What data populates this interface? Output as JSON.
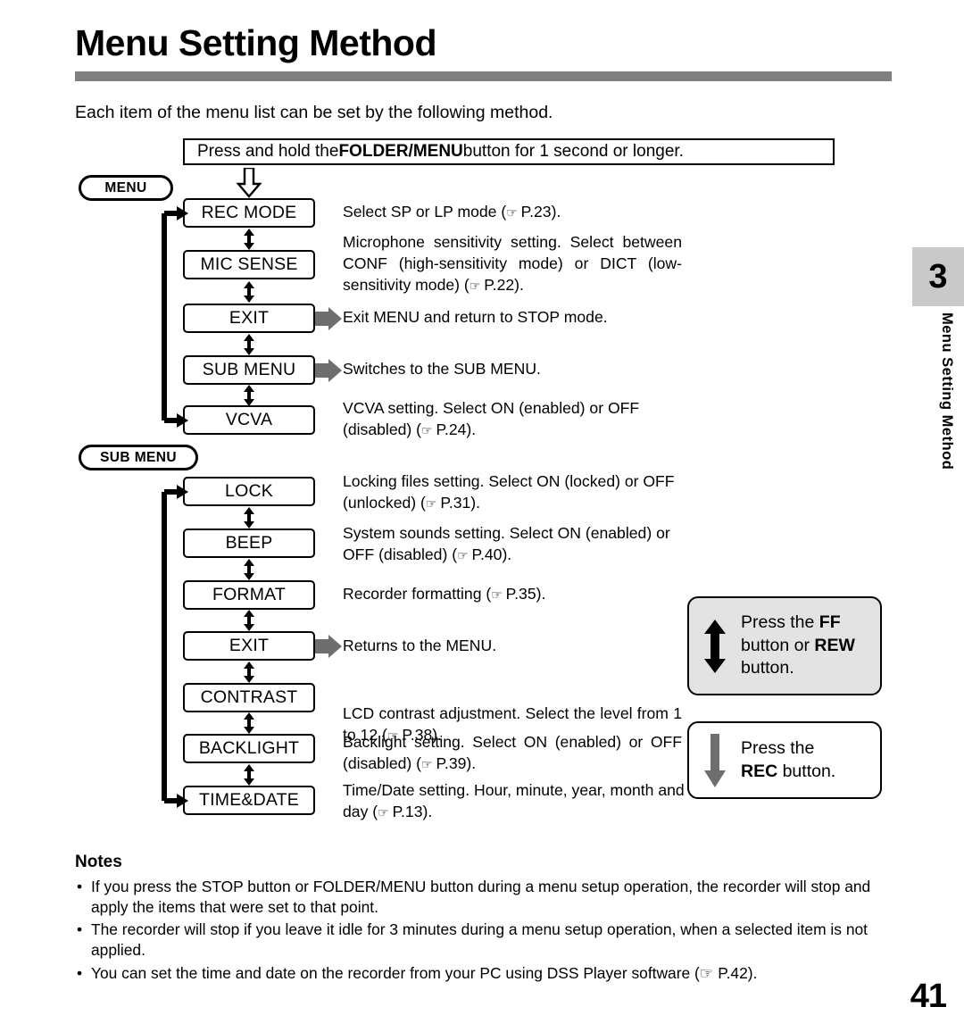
{
  "page": {
    "title": "Menu Setting Method",
    "intro": "Each item of the menu list can be set by the following method.",
    "number": "41",
    "rule_color": "#808080"
  },
  "side_tab": {
    "chapter": "3",
    "label": "Menu Setting Method",
    "bg_color": "#c9c9c9"
  },
  "instruction": {
    "prefix": "Press and hold the ",
    "bold": "FOLDER/MENU",
    "suffix": " button for 1 second or longer.",
    "arrow_icon": "down-arrow-outline-icon"
  },
  "menu": {
    "pill_label": "MENU",
    "items": [
      {
        "box": "REC MODE",
        "desc_pre": "Select SP or LP mode (",
        "hand": "☞",
        "desc_post": " P.23).",
        "has_gray_arrow": false
      },
      {
        "box": "MIC SENSE",
        "desc_pre": "Microphone sensitivity setting. Select between CONF (high-sensitivity mode) or DICT (low-sensitivity mode) (",
        "hand": "☞",
        "desc_post": " P.22).",
        "has_gray_arrow": false
      },
      {
        "box": "EXIT",
        "desc_pre": "Exit MENU and return to STOP mode.",
        "hand": "",
        "desc_post": "",
        "has_gray_arrow": true
      },
      {
        "box": "SUB MENU",
        "desc_pre": "Switches to the SUB MENU.",
        "hand": "",
        "desc_post": "",
        "has_gray_arrow": true
      },
      {
        "box": "VCVA",
        "desc_pre": "VCVA setting. Select ON (enabled) or OFF (disabled) (",
        "hand": "☞",
        "desc_post": " P.24).",
        "has_gray_arrow": false
      }
    ]
  },
  "sub_menu": {
    "pill_label": "SUB MENU",
    "items": [
      {
        "box": "LOCK",
        "desc_pre": "Locking files setting. Select ON (locked) or OFF (unlocked) (",
        "hand": "☞",
        "desc_post": " P.31).",
        "has_gray_arrow": false
      },
      {
        "box": "BEEP",
        "desc_pre": "System sounds setting. Select ON (enabled) or OFF (disabled) (",
        "hand": "☞",
        "desc_post": " P.40).",
        "has_gray_arrow": false
      },
      {
        "box": "FORMAT",
        "desc_pre": "Recorder formatting (",
        "hand": "☞",
        "desc_post": " P.35).",
        "has_gray_arrow": false
      },
      {
        "box": "EXIT",
        "desc_pre": "Returns to the MENU.",
        "hand": "",
        "desc_post": "",
        "has_gray_arrow": true
      },
      {
        "box": "CONTRAST",
        "desc_pre": "LCD contrast adjustment. Select the level from 1 to 12 (",
        "hand": "☞",
        "desc_post": " P.38).",
        "has_gray_arrow": false
      },
      {
        "box": "BACKLIGHT",
        "desc_pre": "Backlight setting. Select ON (enabled) or OFF (disabled) (",
        "hand": "☞",
        "desc_post": " P.39).",
        "has_gray_arrow": false
      },
      {
        "box": "TIME&DATE",
        "desc_pre": "Time/Date setting. Hour, minute, year, month and day (",
        "hand": "☞",
        "desc_post": " P.13).",
        "has_gray_arrow": false
      }
    ]
  },
  "callouts": {
    "ff": {
      "icon": "up-down-arrow-icon",
      "line1_pre": "Press the ",
      "line1_bold": "FF",
      "line2_pre": "button or ",
      "line2_bold": "REW",
      "line3": "button.",
      "bg_color": "#e3e3e3"
    },
    "rec": {
      "icon": "down-arrow-icon",
      "line1": "Press the ",
      "line2_bold": "REC",
      "line2_suffix": " button.",
      "bg_color": "#ffffff"
    }
  },
  "notes": {
    "heading": "Notes",
    "bullet": "•",
    "items": [
      "If you press the STOP button or FOLDER/MENU button during a menu setup operation, the recorder will stop and apply the items that were set to that point.",
      "The recorder will stop if you leave it idle for 3 minutes during a menu setup operation, when a selected item is not applied.",
      "You can set the time and date on the recorder from your PC using DSS Player software (☞ P.42)."
    ]
  }
}
